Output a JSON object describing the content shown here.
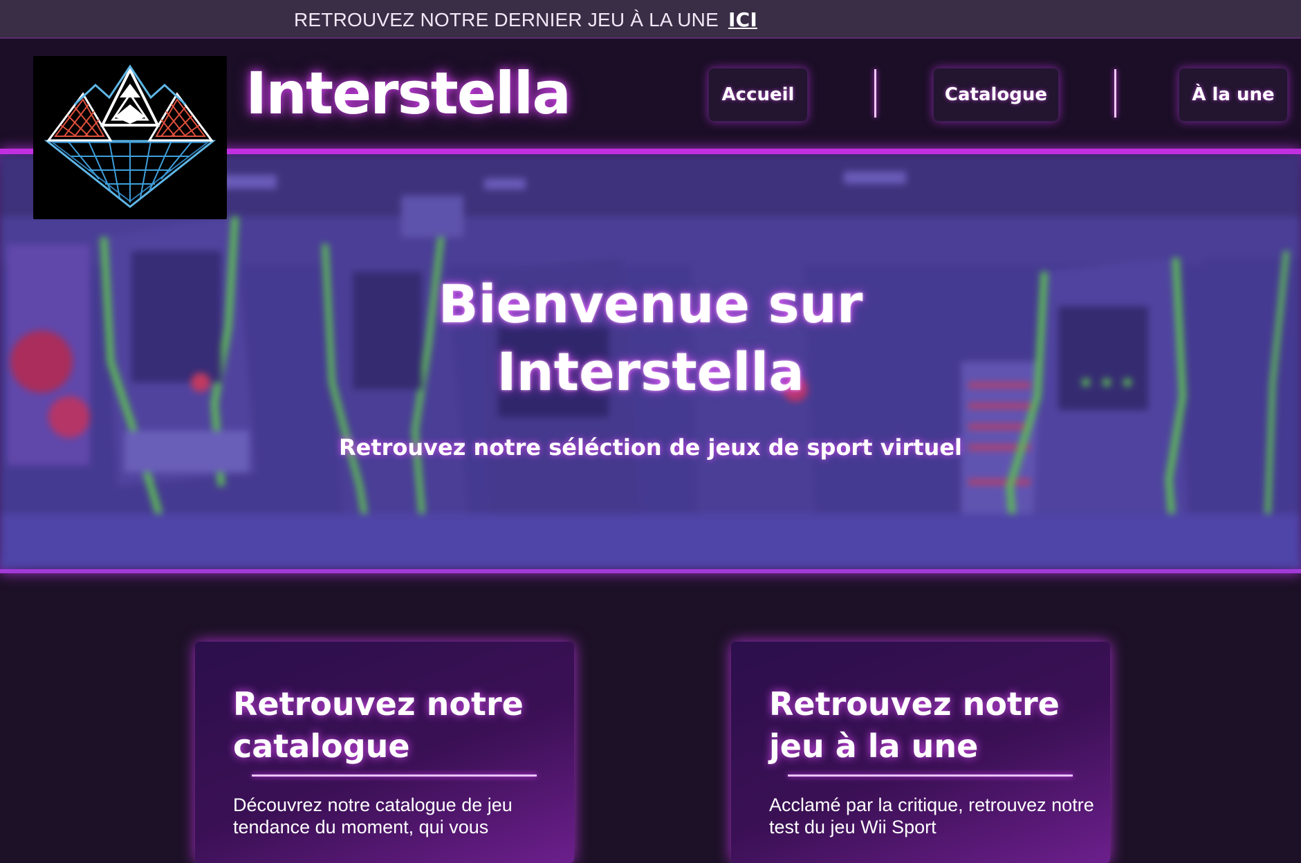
{
  "topbar": {
    "text": "RETROUVEZ NOTRE DERNIER JEU À LA UNE",
    "link": "ICI"
  },
  "header": {
    "brand": "Interstella",
    "nav": [
      {
        "label": "Accueil"
      },
      {
        "label": "Catalogue"
      },
      {
        "label": "À la une"
      }
    ]
  },
  "hero": {
    "title_line1": "Bienvenue sur",
    "title_line2": "Interstella",
    "subtitle": "Retrouvez notre séléction de jeux de sport virtuel"
  },
  "cards": [
    {
      "title_line1": "Retrouvez notre",
      "title_line2": "catalogue",
      "text": "Découvrez notre catalogue de jeu tendance du moment, qui vous"
    },
    {
      "title_line1": "Retrouvez notre",
      "title_line2": "jeu à la une",
      "text": "Acclamé par la critique, retrouvez notre test du jeu Wii Sport"
    }
  ],
  "colors": {
    "page_bg": "#1c1126",
    "topbar_bg": "#3a2d46",
    "neon_accent": "#c22fe0",
    "card_gradient_end": "#6c1f8c"
  },
  "icons": {
    "logo": "pyramid-grid-logo-icon"
  }
}
